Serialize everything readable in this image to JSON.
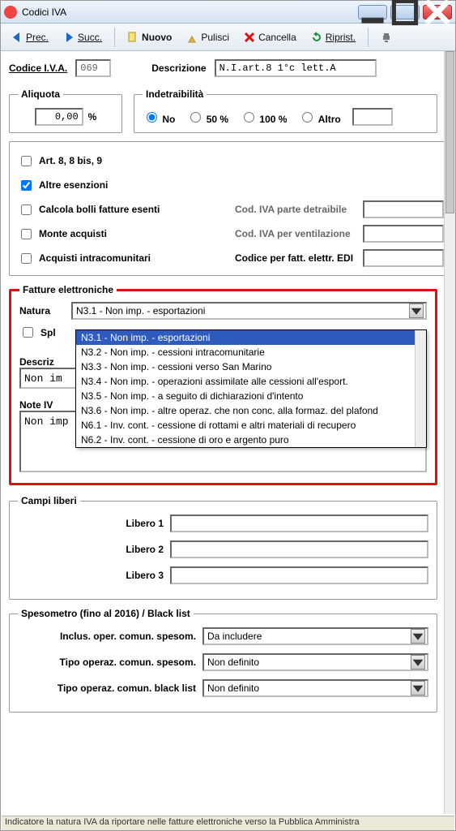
{
  "window": {
    "title": "Codici IVA"
  },
  "toolbar": {
    "prev": "Prec.",
    "succ": "Succ.",
    "nuovo": "Nuovo",
    "pulisci": "Pulisci",
    "cancella": "Cancella",
    "riprist": "Riprist."
  },
  "header": {
    "codice_label": "Codice I.V.A.",
    "codice_value": "069",
    "descrizione_label": "Descrizione",
    "descrizione_value": "N.I.art.8 1°c lett.A"
  },
  "aliquota": {
    "legend": "Aliquota",
    "value": "0,00",
    "percent": "%"
  },
  "indet": {
    "legend": "Indetraibilità",
    "opts": [
      "No",
      "50 %",
      "100 %",
      "Altro"
    ],
    "selected": "No",
    "altro_value": ""
  },
  "checks": {
    "art8": "Art. 8, 8 bis, 9",
    "art8_checked": false,
    "altre": "Altre esenzioni",
    "altre_checked": true,
    "bolli": "Calcola bolli fatture esenti",
    "bolli_checked": false,
    "monte": "Monte acquisti",
    "monte_checked": false,
    "intra": "Acquisti intracomunitari",
    "intra_checked": false,
    "cod_detraibile_label": "Cod. IVA parte detraibile",
    "cod_detraibile_value": "",
    "cod_ventilazione_label": "Cod. IVA per ventilazione",
    "cod_ventilazione_value": "",
    "codice_edi_label": "Codice per fatt. elettr. EDI",
    "codice_edi_value": ""
  },
  "fatture": {
    "legend": "Fatture elettroniche",
    "natura_label": "Natura",
    "natura_selected": "N3.1 - Non imp. - esportazioni",
    "natura_options": [
      "N3.1 - Non imp. - esportazioni",
      "N3.2 - Non imp. - cessioni intracomunitarie",
      "N3.3 - Non imp. - cessioni verso San Marino",
      "N3.4 - Non imp. - operazioni assimilate alle cessioni all'esport.",
      "N3.5 - Non imp. - a seguito di dichiarazioni d'intento",
      "N3.6 - Non imp. - altre operaz. che non conc. alla formaz. del plafond",
      "N6.1 - Inv. cont. - cessione di rottami e altri materiali di recupero",
      "N6.2 - Inv. cont. - cessione di oro e argento puro"
    ],
    "spl_checked": false,
    "spl_label": "Spl",
    "descriz_label": "Descriz",
    "descriz_value": "Non im",
    "note_label": "Note IV",
    "note_value": "Non imp"
  },
  "campi_liberi": {
    "legend": "Campi liberi",
    "libero1_label": "Libero 1",
    "libero1_value": "",
    "libero2_label": "Libero 2",
    "libero2_value": "",
    "libero3_label": "Libero 3",
    "libero3_value": ""
  },
  "spesometro": {
    "legend": "Spesometro (fino al 2016) / Black list",
    "inclus_label": "Inclus. oper. comun. spesom.",
    "inclus_value": "Da includere",
    "tipo_spesom_label": "Tipo operaz. comun. spesom.",
    "tipo_spesom_value": "Non definito",
    "tipo_black_label": "Tipo operaz. comun. black list",
    "tipo_black_value": "Non definito"
  },
  "status": "Indicatore la natura IVA da riportare nelle fatture elettroniche verso la Pubblica Amministra"
}
